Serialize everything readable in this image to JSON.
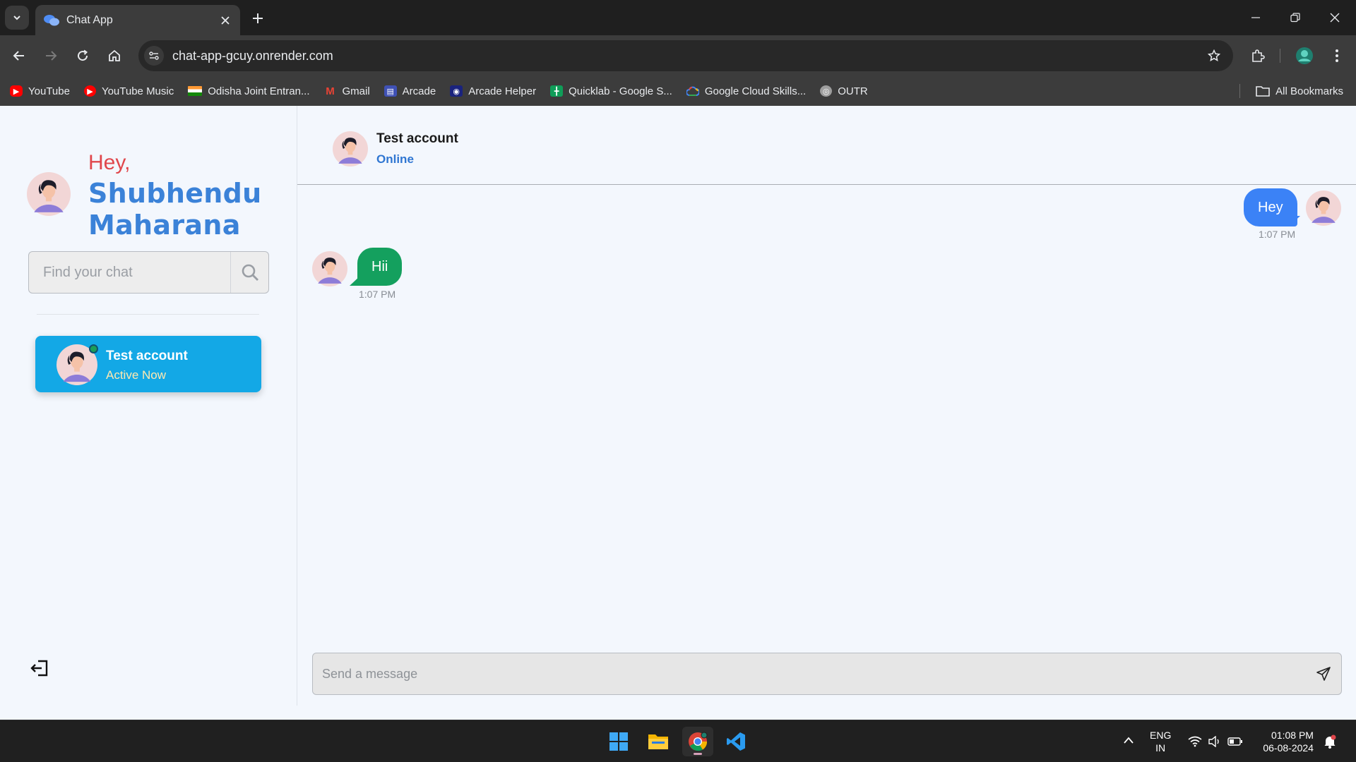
{
  "browser": {
    "tab_title": "Chat App",
    "url": "chat-app-gcuy.onrender.com",
    "bookmarks": [
      {
        "label": "YouTube",
        "icon": "youtube-icon",
        "color": "#ff0000"
      },
      {
        "label": "YouTube Music",
        "icon": "youtube-music-icon",
        "color": "#ff0000"
      },
      {
        "label": "Odisha Joint Entran...",
        "icon": "india-flag-icon",
        "color": "#ff9933"
      },
      {
        "label": "Gmail",
        "icon": "gmail-icon",
        "color": "#ea4335"
      },
      {
        "label": "Arcade",
        "icon": "arcade-icon",
        "color": "#3f51b5"
      },
      {
        "label": "Arcade Helper",
        "icon": "arcade-helper-icon",
        "color": "#1a237e"
      },
      {
        "label": "Quicklab - Google S...",
        "icon": "sheets-icon",
        "color": "#0f9d58"
      },
      {
        "label": "Google Cloud Skills...",
        "icon": "google-cloud-icon",
        "color": "#4285f4"
      },
      {
        "label": "OUTR",
        "icon": "outr-icon",
        "color": "#9e9e9e"
      }
    ],
    "all_bookmarks": "All Bookmarks"
  },
  "sidebar": {
    "greeting": "Hey,",
    "user_name": "Shubhendu Maharana",
    "search_placeholder": "Find your chat",
    "chats": [
      {
        "name": "Test account",
        "status": "Active Now",
        "online": true
      }
    ]
  },
  "chat": {
    "contact_name": "Test account",
    "contact_status": "Online",
    "messages": [
      {
        "text": "Hey",
        "time": "1:07 PM",
        "direction": "outgoing"
      },
      {
        "text": "Hii",
        "time": "1:07 PM",
        "direction": "incoming"
      }
    ],
    "composer_placeholder": "Send a message"
  },
  "taskbar": {
    "lang_line1": "ENG",
    "lang_line2": "IN",
    "time": "01:08 PM",
    "date": "06-08-2024"
  },
  "colors": {
    "accent_blue": "#3b82f6",
    "incoming_green": "#14a05e",
    "greeting_red": "#e0474c",
    "active_card": "#13a8e6"
  }
}
